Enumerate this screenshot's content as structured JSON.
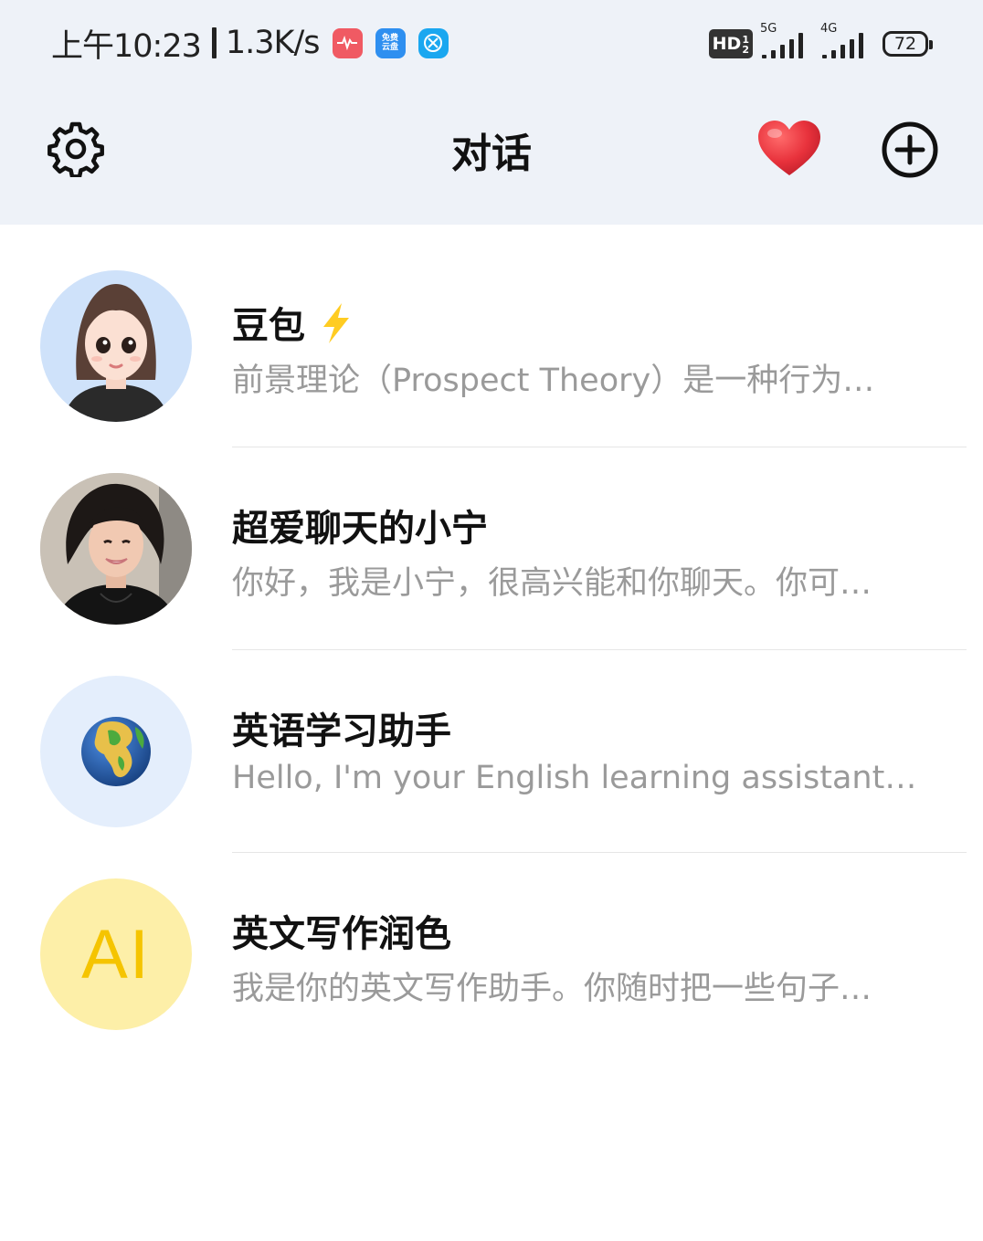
{
  "status_bar": {
    "time": "上午10:23",
    "net_speed": "1.3K/s",
    "app_icons": [
      "health-app-icon",
      "cloud-app-icon",
      "security-app-icon"
    ],
    "cloud_icon_text_top": "免费",
    "cloud_icon_text_bottom": "云盘",
    "hd_label": "HD",
    "hd_sub_top": "1",
    "hd_sub_bottom": "2",
    "sim1_network": "5G",
    "sim2_network": "4G",
    "battery": "72"
  },
  "header": {
    "title": "对话",
    "icons": [
      "gear-icon",
      "heart-icon",
      "plus-circle-icon"
    ]
  },
  "conversations": [
    {
      "name": "豆包",
      "badge_icon": "lightning-icon",
      "preview": "前景理论（Prospect Theory）是一种行为…",
      "avatar": "cartoon-girl-avatar"
    },
    {
      "name": "超爱聊天的小宁",
      "preview": "你好，我是小宁，很高兴能和你聊天。你可…",
      "avatar": "photo-girl-avatar"
    },
    {
      "name": "英语学习助手",
      "preview": "Hello, I'm your English learning assistant…",
      "avatar": "globe-avatar"
    },
    {
      "name": "英文写作润色",
      "preview": "我是你的英文写作助手。你随时把一些句子…",
      "avatar": "ai-text-avatar",
      "avatar_text": "AI"
    }
  ],
  "colors": {
    "header_bg": "#eef2f8",
    "preview_text": "#9a9a9a",
    "heart": "#e8323c",
    "ai_avatar_bg": "#fdefa8",
    "ai_avatar_text": "#f5c400",
    "globe_avatar_bg": "#e4eefc",
    "doubao_avatar_bg": "#cfe2fa"
  }
}
